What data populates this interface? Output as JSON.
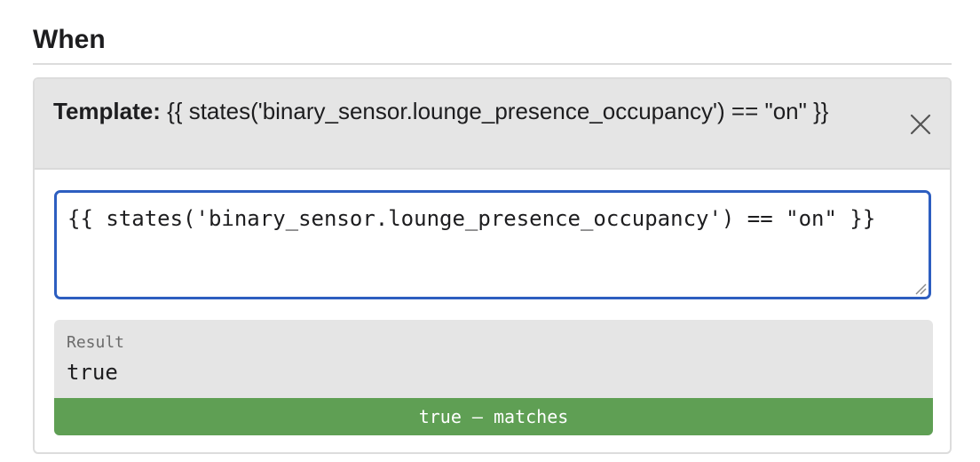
{
  "section": {
    "title": "When"
  },
  "condition": {
    "label": "Template:",
    "summary": "{{ states('binary_sensor.lounge_presence_occupancy') == \"on\" }}",
    "close_icon": "close-icon"
  },
  "editor": {
    "value": "{{ states('binary_sensor.lounge_presence_occupancy') == \"on\" }}"
  },
  "result": {
    "label": "Result",
    "value": "true",
    "status": "true — matches",
    "status_color": "#5f9f54"
  },
  "colors": {
    "editor_border": "#2d5ec0",
    "header_background": "#e5e5e5"
  }
}
